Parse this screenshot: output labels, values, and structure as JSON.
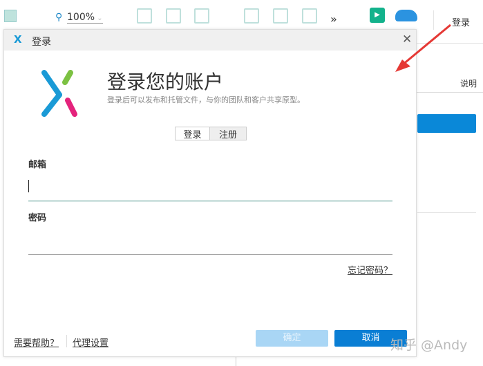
{
  "toolbar": {
    "zoom": "100%",
    "more": "»",
    "login": "登录"
  },
  "background": {
    "column_header": "说明"
  },
  "dialog": {
    "title": "登录",
    "heading": "登录您的账户",
    "subtitle": "登录后可以发布和托管文件，与你的团队和客户共享原型。",
    "tabs": [
      {
        "label": "登录",
        "active": true
      },
      {
        "label": "注册",
        "active": false
      }
    ],
    "email_label": "邮箱",
    "email_value": "",
    "password_label": "密码",
    "password_value": "",
    "forgot": "忘记密码？",
    "help": "需要帮助？",
    "proxy": "代理设置",
    "ok": "确定",
    "cancel": "取消"
  },
  "watermark": "知乎 @Andy",
  "colors": {
    "primary": "#0a7ed4",
    "primary_disabled": "#a9d6f5",
    "accent_teal": "#bfe0dc",
    "arrow": "#e53935"
  }
}
